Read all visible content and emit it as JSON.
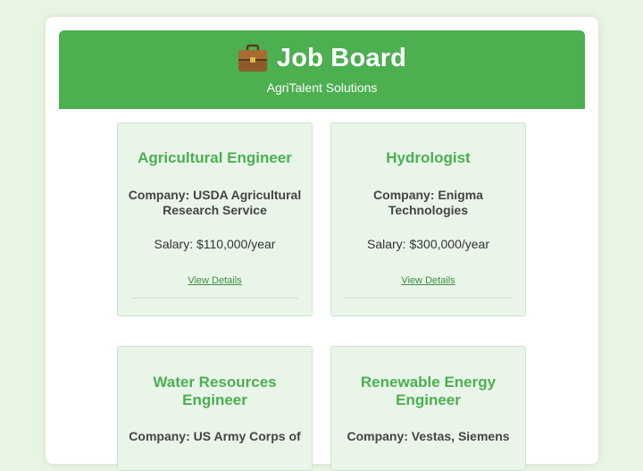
{
  "header": {
    "icon": "briefcase-icon",
    "title": "Job Board",
    "subtitle": "AgriTalent Solutions"
  },
  "jobs": [
    {
      "title": "Agricultural Engineer",
      "company": "Company: USDA Agricultural Research Service",
      "salary": "Salary: $110,000/year",
      "link": "View Details"
    },
    {
      "title": "Hydrologist",
      "company": "Company: Enigma Technologies",
      "salary": "Salary: $300,000/year",
      "link": "View Details"
    },
    {
      "title": "Water Resources Engineer",
      "company": "Company: US Army Corps of"
    },
    {
      "title": "Renewable Energy Engineer",
      "company": "Company: Vestas, Siemens"
    }
  ],
  "colors": {
    "background": "#e9f5e3",
    "header": "#4caf50",
    "card": "#e9f5e9",
    "accent": "#4caf50"
  }
}
